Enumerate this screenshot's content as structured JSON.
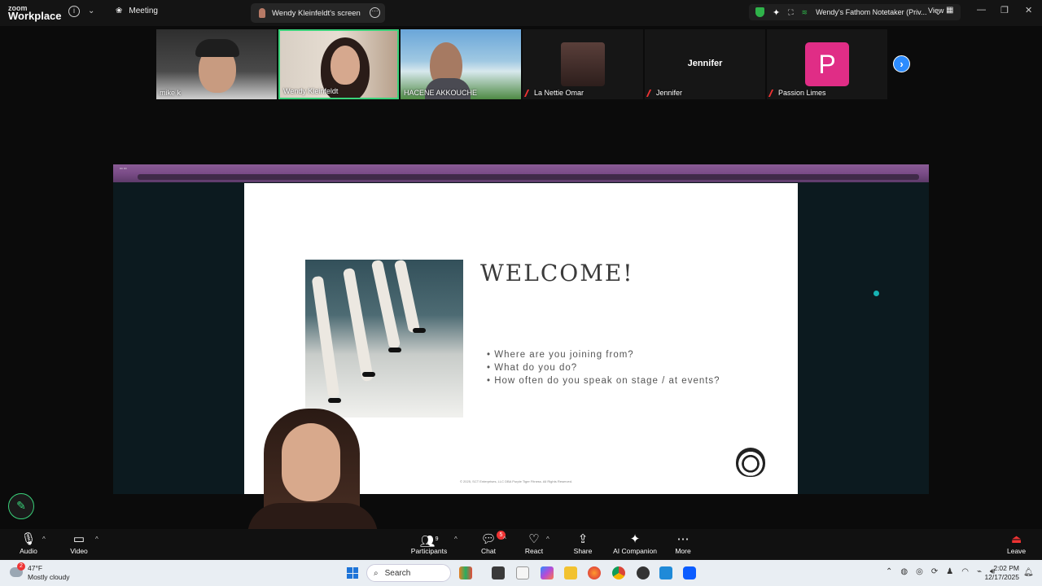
{
  "app": {
    "logo_line1": "zoom",
    "logo_line2": "Workplace",
    "meeting_label": "Meeting",
    "screen_tab_label": "Wendy Kleinfeldt's screen",
    "notetaker_label": "Wendy's Fathom Notetaker (Priv...",
    "view_label": "View"
  },
  "participants": [
    {
      "name": "mike k",
      "muted": false
    },
    {
      "name": "Wendy Kleinfeldt",
      "muted": false,
      "active": true
    },
    {
      "name": "HACENE AKKOUCHE",
      "muted": false
    },
    {
      "name": "La Nettie Omar",
      "muted": true
    },
    {
      "name": "Jennifer",
      "muted": true,
      "display_name": "Jennifer"
    },
    {
      "name": "Passion Limes",
      "muted": true,
      "initial": "P"
    }
  ],
  "slide": {
    "title": "WELCOME!",
    "bullets": [
      "Where are you joining from?",
      "What do you do?",
      "How often do you speak on stage / at events?"
    ],
    "footer": "© 2025, SCT Enterprises, LLC DBA Purple Tiger Fitness. All Rights Reserved."
  },
  "toolbar": {
    "audio": "Audio",
    "video": "Video",
    "participants": "Participants",
    "participants_count": "9",
    "chat": "Chat",
    "chat_badge": "5",
    "react": "React",
    "share": "Share",
    "ai_companion": "AI Companion",
    "more": "More",
    "leave": "Leave"
  },
  "taskbar": {
    "weather_temp": "47°F",
    "weather_desc": "Mostly cloudy",
    "weather_badge": "2",
    "search": "Search",
    "time": "2:02 PM",
    "date": "12/17/2025"
  },
  "colors": {
    "active_border": "#3ad27a",
    "leave_red": "#e33333",
    "passion_avatar": "#e02d86",
    "accent_blue": "#2d8cff"
  }
}
